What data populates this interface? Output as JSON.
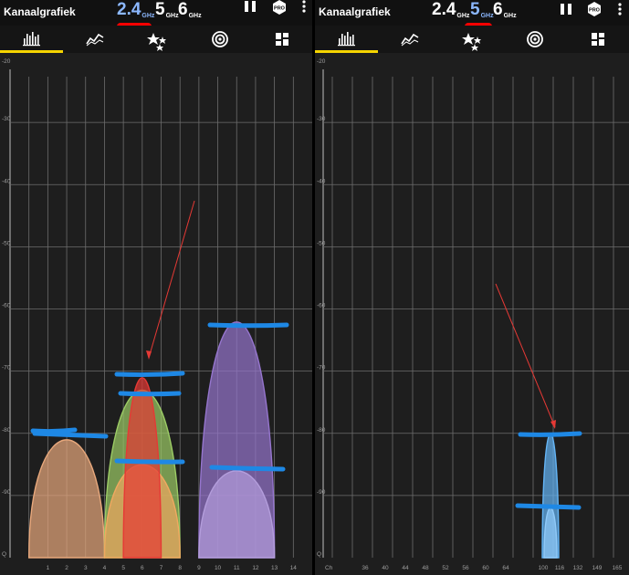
{
  "left": {
    "title": "Kanaalgrafiek",
    "bands": [
      {
        "value": "2.4",
        "unit": "GHz",
        "active": true
      },
      {
        "value": "5",
        "unit": "GHz",
        "active": false
      },
      {
        "value": "6",
        "unit": "GHz",
        "active": false
      }
    ],
    "pro_label": "PRO",
    "tabs": [
      "bar-chart-icon",
      "line-chart-icon",
      "stars-icon",
      "radar-icon",
      "dashboard-icon"
    ],
    "active_tab": 0,
    "y_ticks": [
      "-20",
      "-30",
      "-40",
      "-50",
      "-60",
      "-70",
      "-80",
      "-90",
      "Q"
    ],
    "x_ticks": [
      "1",
      "2",
      "3",
      "4",
      "5",
      "6",
      "7",
      "8",
      "9",
      "10",
      "11",
      "12",
      "13",
      "14"
    ]
  },
  "right": {
    "title": "Kanaalgrafiek",
    "bands": [
      {
        "value": "2.4",
        "unit": "GHz",
        "active": false
      },
      {
        "value": "5",
        "unit": "GHz",
        "active": true
      },
      {
        "value": "6",
        "unit": "GHz",
        "active": false
      }
    ],
    "pro_label": "PRO",
    "tabs": [
      "bar-chart-icon",
      "line-chart-icon",
      "stars-icon",
      "radar-icon",
      "dashboard-icon"
    ],
    "active_tab": 0,
    "y_ticks": [
      "-20",
      "-30",
      "-40",
      "-50",
      "-60",
      "-70",
      "-80",
      "-90",
      "Q"
    ],
    "x_prefix": "Ch",
    "x_ticks": [
      "36",
      "40",
      "44",
      "48",
      "52",
      "56",
      "60",
      "64",
      "100",
      "116",
      "132",
      "149",
      "165"
    ]
  },
  "chart_data": [
    {
      "type": "area",
      "ylim": [
        -100,
        -20
      ],
      "xlim": [
        -1,
        15
      ],
      "series": [
        {
          "channel": 2,
          "width": 4,
          "level": -81,
          "color": "#e8a87c"
        },
        {
          "channel": 6,
          "width": 4,
          "level": -73,
          "color": "#9ccc65"
        },
        {
          "channel": 6,
          "width": 4,
          "level": -85,
          "color": "#f0a860"
        },
        {
          "channel": 6,
          "width": 2,
          "level": -71,
          "color": "#e53935"
        },
        {
          "channel": 11,
          "width": 4,
          "level": -62,
          "color": "#9575cd"
        },
        {
          "channel": 11,
          "width": 4,
          "level": -86,
          "color": "#b39ddb"
        }
      ]
    },
    {
      "type": "area",
      "ylim": [
        -100,
        -20
      ],
      "series": [
        {
          "channel": "108",
          "level": -80,
          "color": "#64b5f6"
        },
        {
          "channel": "108",
          "level": -92,
          "color": "#90caf9"
        }
      ]
    }
  ]
}
